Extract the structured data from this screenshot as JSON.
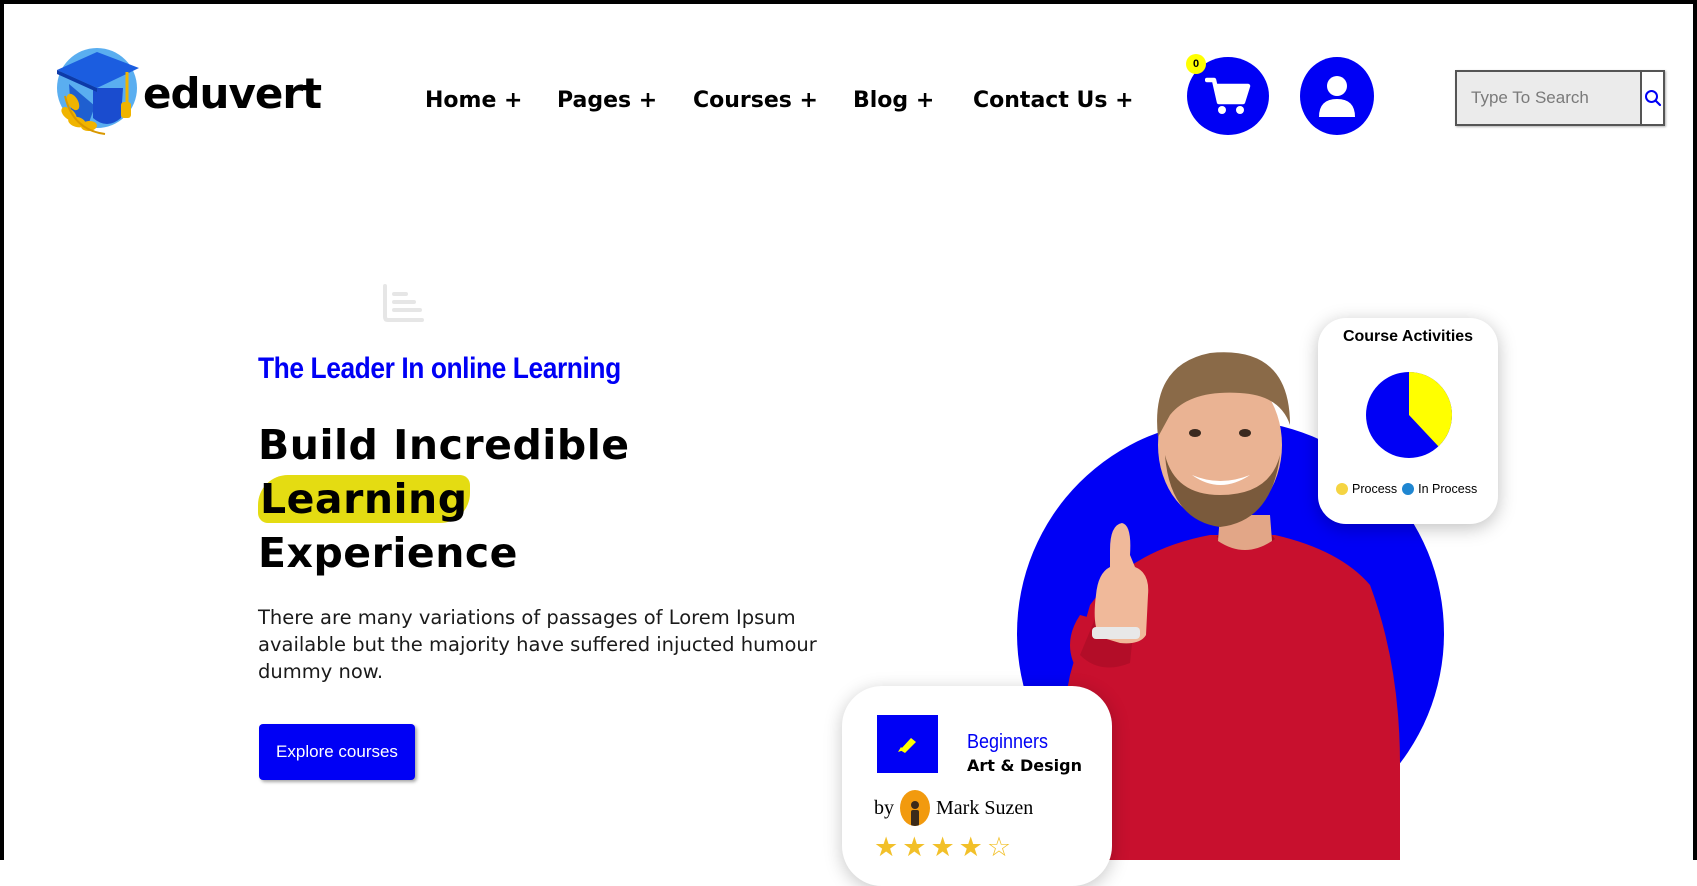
{
  "brand": {
    "name": "eduvert"
  },
  "nav": {
    "items": [
      {
        "label": "Home +"
      },
      {
        "label": "Pages +"
      },
      {
        "label": "Courses +"
      },
      {
        "label": "Blog +"
      },
      {
        "label": "Contact Us +"
      }
    ]
  },
  "cart": {
    "count": "0",
    "icon": "cart-icon"
  },
  "user": {
    "icon": "user-icon"
  },
  "search": {
    "placeholder": "Type To Search",
    "icon": "search-icon"
  },
  "hero": {
    "tagline": "The Leader In online Learning",
    "headline_line1": "Build Incredible",
    "headline_highlight": "Learning",
    "headline_line3": "Experience",
    "description": "There are many variations of passages of Lorem Ipsum available but the majority have suffered injucted humour dummy now.",
    "cta_label": "Explore courses"
  },
  "activities_card": {
    "title": "Course Activities",
    "legend": [
      {
        "label": "Process",
        "color": "#f5d442"
      },
      {
        "label": "In Process",
        "color": "#1f86d1"
      }
    ],
    "pie_colors": {
      "process": "#ffff00",
      "in_process": "#0000f5"
    },
    "process_fraction": 0.38
  },
  "course_card": {
    "level": "Beginners",
    "category": "Art & Design",
    "by_label": "by",
    "instructor": "Mark Suzen",
    "rating": 4,
    "rating_max": 5
  },
  "colors": {
    "accent": "#0000f5",
    "highlight": "#e4dc12",
    "star": "#f2c029"
  }
}
